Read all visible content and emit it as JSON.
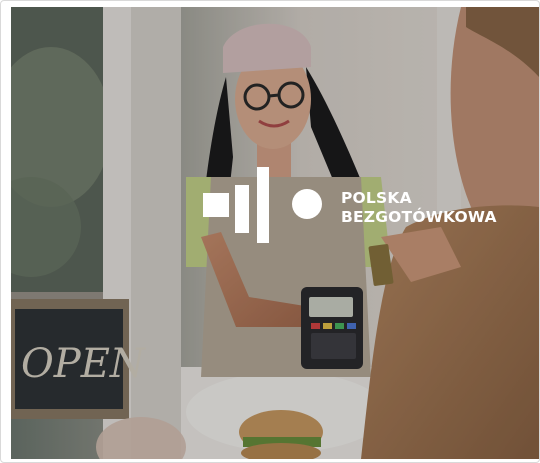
{
  "photo": {
    "description_icon": "photo",
    "sign_text": "OPEN"
  },
  "logo": {
    "line1": "POLSKA",
    "line2": "BEZGOTÓWKOWA",
    "color": "#ffffff"
  }
}
